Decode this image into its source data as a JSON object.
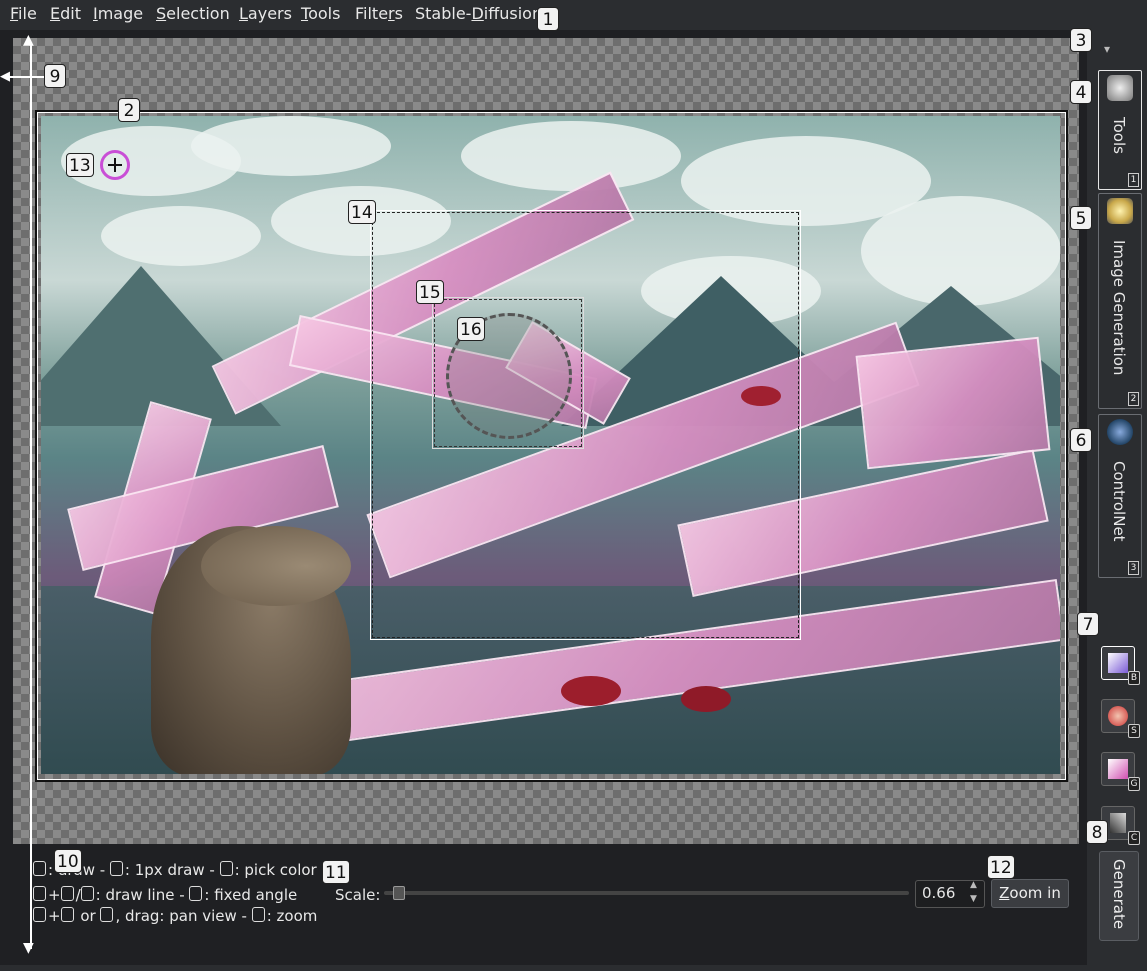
{
  "menu": {
    "file": {
      "pre": "",
      "ul": "F",
      "post": "ile"
    },
    "edit": {
      "pre": "",
      "ul": "E",
      "post": "dit"
    },
    "image": {
      "pre": "",
      "ul": "I",
      "post": "mage"
    },
    "selection": {
      "pre": "",
      "ul": "S",
      "post": "election"
    },
    "layers": {
      "pre": "",
      "ul": "L",
      "post": "ayers"
    },
    "tools": {
      "pre": "",
      "ul": "T",
      "post": "ools"
    },
    "filters": {
      "pre": "Filte",
      "ul": "r",
      "post": "s"
    },
    "stable_diffusion": {
      "pre": "Stable-",
      "ul": "D",
      "post": "iffusion"
    }
  },
  "hints": {
    "line1_a": ": draw - ",
    "line1_b": ": 1px draw - ",
    "line1_c": ": pick color",
    "line2_a": "+",
    "line2_b": "/",
    "line2_c": ": draw line - ",
    "line2_d": ": fixed angle",
    "line3_a": "+",
    "line3_b": " or ",
    "line3_c": ", drag: pan view - ",
    "line3_d": ": zoom"
  },
  "scale": {
    "label": "Scale:",
    "value": "0.66",
    "up": "▲",
    "down": "▼"
  },
  "zoom_button": {
    "pre": "",
    "ul": "Z",
    "post": "oom in"
  },
  "tabs": [
    {
      "label": "Tools",
      "num": "1"
    },
    {
      "label": "Image Generation",
      "num": "2"
    },
    {
      "label": "ControlNet",
      "num": "3"
    }
  ],
  "tool_buttons": [
    {
      "key": "B",
      "icon": "brush-icon"
    },
    {
      "key": "S",
      "icon": "smudge-icon"
    },
    {
      "key": "G",
      "icon": "generate-area-icon"
    },
    {
      "key": "C",
      "icon": "eyedropper-icon"
    }
  ],
  "generate_label": "Generate",
  "dropdown_glyph": "▾",
  "markers": [
    "1",
    "2",
    "3",
    "4",
    "5",
    "6",
    "7",
    "8",
    "9",
    "10",
    "11",
    "12",
    "13",
    "14",
    "15",
    "16"
  ]
}
